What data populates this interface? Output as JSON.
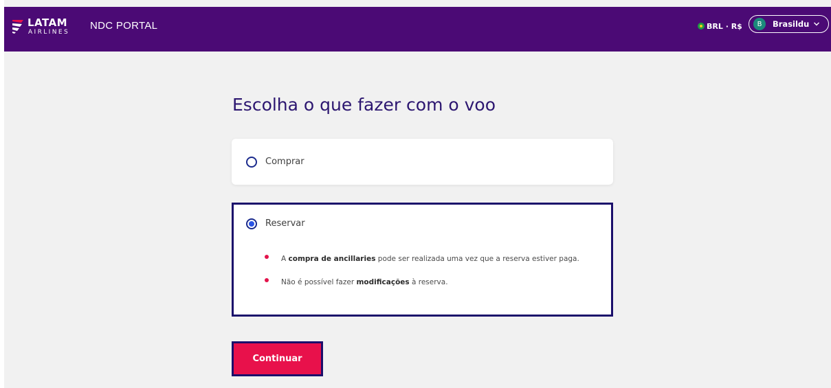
{
  "header": {
    "logo_title": "LATAM",
    "logo_subtitle": "AIRLINES",
    "portal_title": "NDC PORTAL",
    "currency_label": "BRL · R$",
    "user": {
      "initial": "B",
      "name": "Brasildu"
    }
  },
  "main": {
    "heading": "Escolha o que fazer com o voo",
    "options": [
      {
        "label": "Comprar",
        "selected": false
      },
      {
        "label": "Reservar",
        "selected": true,
        "notes": [
          {
            "prefix": "A ",
            "bold": "compra de ancillaries",
            "suffix": " pode ser realizada uma vez que a reserva estiver paga."
          },
          {
            "prefix": "Não é possível fazer ",
            "bold": "modificações",
            "suffix": " à reserva."
          }
        ]
      }
    ],
    "continue_label": "Continuar"
  },
  "colors": {
    "header_bg": "#4b0a75",
    "accent_red": "#e8114b",
    "selected_border": "#1b0f6b",
    "heading": "#2c1670"
  },
  "icons": {
    "logo": "latam-logo-icon",
    "flag": "brazil-flag-icon",
    "chevron": "chevron-down-icon"
  }
}
